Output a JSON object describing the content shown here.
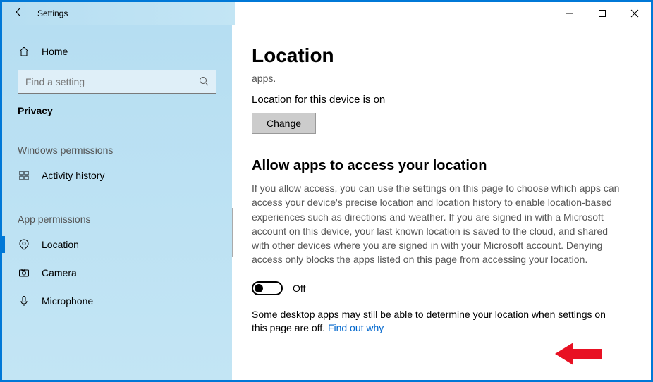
{
  "titlebar": {
    "title": "Settings"
  },
  "sidebar": {
    "home_label": "Home",
    "search_placeholder": "Find a setting",
    "active_category": "Privacy",
    "section_windows": "Windows permissions",
    "section_app": "App permissions",
    "items": {
      "activity_history": "Activity history",
      "location": "Location",
      "camera": "Camera",
      "microphone": "Microphone"
    }
  },
  "content": {
    "heading": "Location",
    "truncated_top": "apps.",
    "device_status": "Location for this device is on",
    "change_button": "Change",
    "allow_heading": "Allow apps to access your location",
    "allow_paragraph": "If you allow access, you can use the settings on this page to choose which apps can access your device's precise location and location history to enable location-based experiences such as directions and weather. If you are signed in with a Microsoft account on this device, your last known location is saved to the cloud, and shared with other devices where you are signed in with your Microsoft account. Denying access only blocks the apps listed on this page from accessing your location.",
    "toggle_state": "Off",
    "footer_text": "Some desktop apps may still be able to determine your location when settings on this page are off. ",
    "footer_link": "Find out why"
  }
}
